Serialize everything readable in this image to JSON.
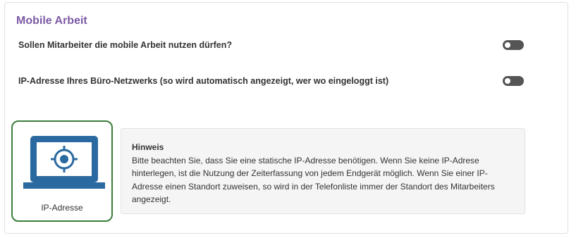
{
  "section": {
    "title": "Mobile Arbeit",
    "rows": [
      {
        "label": "Sollen Mitarbeiter die mobile Arbeit nutzen dürfen?",
        "enabled": false
      },
      {
        "label": "IP-Adresse Ihres Büro-Netzwerks (so wird automatisch angezeigt, wer wo eingeloggt ist)",
        "enabled": false
      }
    ]
  },
  "card": {
    "icon": "laptop-target-icon",
    "label": "IP-Adresse",
    "border_color": "#3c7f3a",
    "icon_color": "#2b6aa0"
  },
  "hint": {
    "title": "Hinweis",
    "text": "Bitte beachten Sie, dass Sie eine statische IP-Adresse benötigen. Wenn Sie keine IP-Adrese hinterlegen, ist die Nutzung der Zeiterfassung von jedem Endgerät möglich. Wenn Sie einer IP-Adresse einen Standort zuweisen, so wird in der Telefonliste immer der Standort des Mitarbeiters angezeigt."
  },
  "colors": {
    "title": "#7d5ba6",
    "toggle_off": "#555555"
  }
}
